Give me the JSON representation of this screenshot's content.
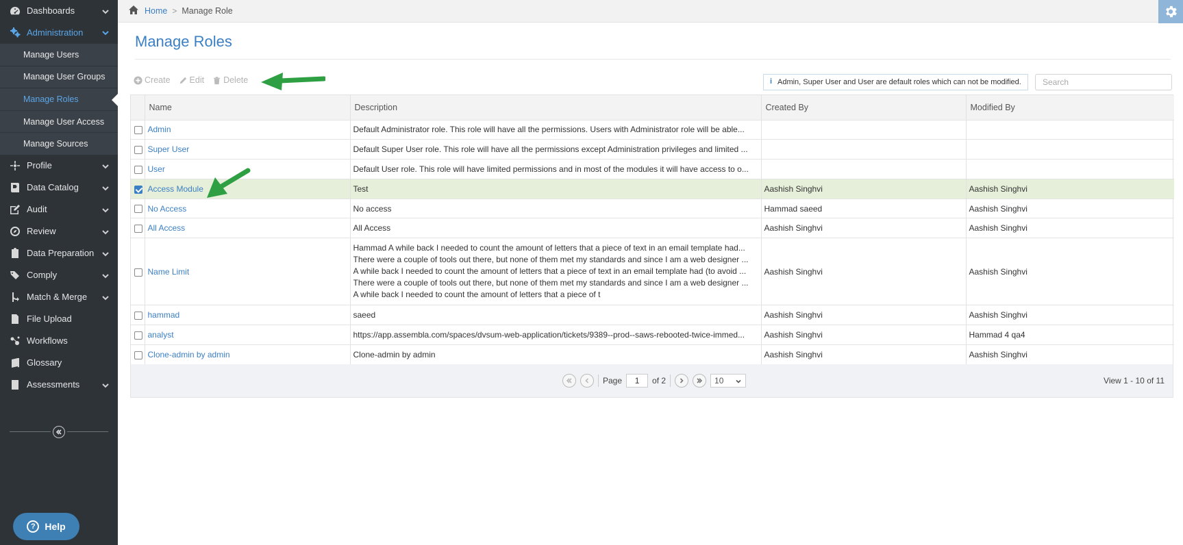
{
  "sidebar": {
    "items": [
      {
        "label": "Dashboards",
        "icon": "dashboard-icon"
      },
      {
        "label": "Administration",
        "icon": "cogs-icon",
        "active": true
      },
      {
        "label": "Profile",
        "icon": "crosshair-icon"
      },
      {
        "label": "Data Catalog",
        "icon": "book-icon"
      },
      {
        "label": "Audit",
        "icon": "edit-icon"
      },
      {
        "label": "Review",
        "icon": "compass-icon"
      },
      {
        "label": "Data Preparation",
        "icon": "clipboard-icon"
      },
      {
        "label": "Comply",
        "icon": "tags-icon"
      },
      {
        "label": "Match & Merge",
        "icon": "merge-icon"
      },
      {
        "label": "File Upload",
        "icon": "file-icon"
      },
      {
        "label": "Workflows",
        "icon": "workflow-icon"
      },
      {
        "label": "Glossary",
        "icon": "glossary-book-icon"
      },
      {
        "label": "Assessments",
        "icon": "assessment-icon"
      }
    ],
    "submenu": [
      "Manage Users",
      "Manage User Groups",
      "Manage Roles",
      "Manage User Access",
      "Manage Sources"
    ],
    "help_label": "Help"
  },
  "breadcrumb": {
    "home": "Home",
    "current": "Manage Role"
  },
  "page_title": "Manage Roles",
  "toolbar": {
    "create": "Create",
    "edit": "Edit",
    "delete": "Delete"
  },
  "info_text": "Admin, Super User and User are default roles which can not be modified.",
  "search": {
    "placeholder": "Search"
  },
  "table": {
    "headers": [
      "Name",
      "Description",
      "Created By",
      "Modified By"
    ],
    "rows": [
      {
        "name": "Admin",
        "description": "Default Administrator role. This role will have all the permissions. Users with Administrator role will be able...",
        "created_by": "",
        "modified_by": "",
        "checked": false
      },
      {
        "name": "Super User",
        "description": "Default Super User role. This role will have all the permissions except Administration privileges and limited ...",
        "created_by": "",
        "modified_by": "",
        "checked": false
      },
      {
        "name": "User",
        "description": "Default User role. This role will have limited permissions and in most of the modules it will have access to o...",
        "created_by": "",
        "modified_by": "",
        "checked": false
      },
      {
        "name": "Access Module",
        "description": "Test",
        "created_by": "Aashish Singhvi",
        "modified_by": "Aashish Singhvi",
        "checked": true
      },
      {
        "name": "No Access",
        "description": "No access",
        "created_by": "Hammad saeed",
        "modified_by": "Aashish Singhvi",
        "checked": false
      },
      {
        "name": "All Access",
        "description": "All Access",
        "created_by": "Aashish Singhvi",
        "modified_by": "Aashish Singhvi",
        "checked": false
      },
      {
        "name": "Name Limit",
        "description_lines": [
          "Hammad A while back I needed to count the amount of letters that a piece of text in an email template had...",
          "There were a couple of tools out there, but none of them met my standards and since I am a web designer ...",
          "A while back I needed to count the amount of letters that a piece of text in an email template had (to avoid ...",
          "There were a couple of tools out there, but none of them met my standards and since I am a web designer ...",
          "A while back I needed to count the amount of letters that a piece of t"
        ],
        "created_by": "Aashish Singhvi",
        "modified_by": "Aashish Singhvi",
        "checked": false
      },
      {
        "name": "hammad",
        "description": "saeed",
        "created_by": "Aashish Singhvi",
        "modified_by": "Aashish Singhvi",
        "checked": false
      },
      {
        "name": "analyst",
        "description": "https://app.assembla.com/spaces/dvsum-web-application/tickets/9389--prod--saws-rebooted-twice-immed...",
        "created_by": "Aashish Singhvi",
        "modified_by": "Hammad 4 qa4",
        "checked": false
      },
      {
        "name": "Clone-admin by admin",
        "description": "Clone-admin by admin",
        "created_by": "Aashish Singhvi",
        "modified_by": "Aashish Singhvi",
        "checked": false
      }
    ]
  },
  "pager": {
    "page_label": "Page",
    "page_value": "1",
    "of_label": "of 2",
    "page_size": "10",
    "view_text": "View 1 - 10 of 11"
  },
  "colors": {
    "accent": "#3b7fc4",
    "sidebar_bg": "#2e3338",
    "selected_row": "#e6efd9",
    "arrow": "#2ea043"
  }
}
